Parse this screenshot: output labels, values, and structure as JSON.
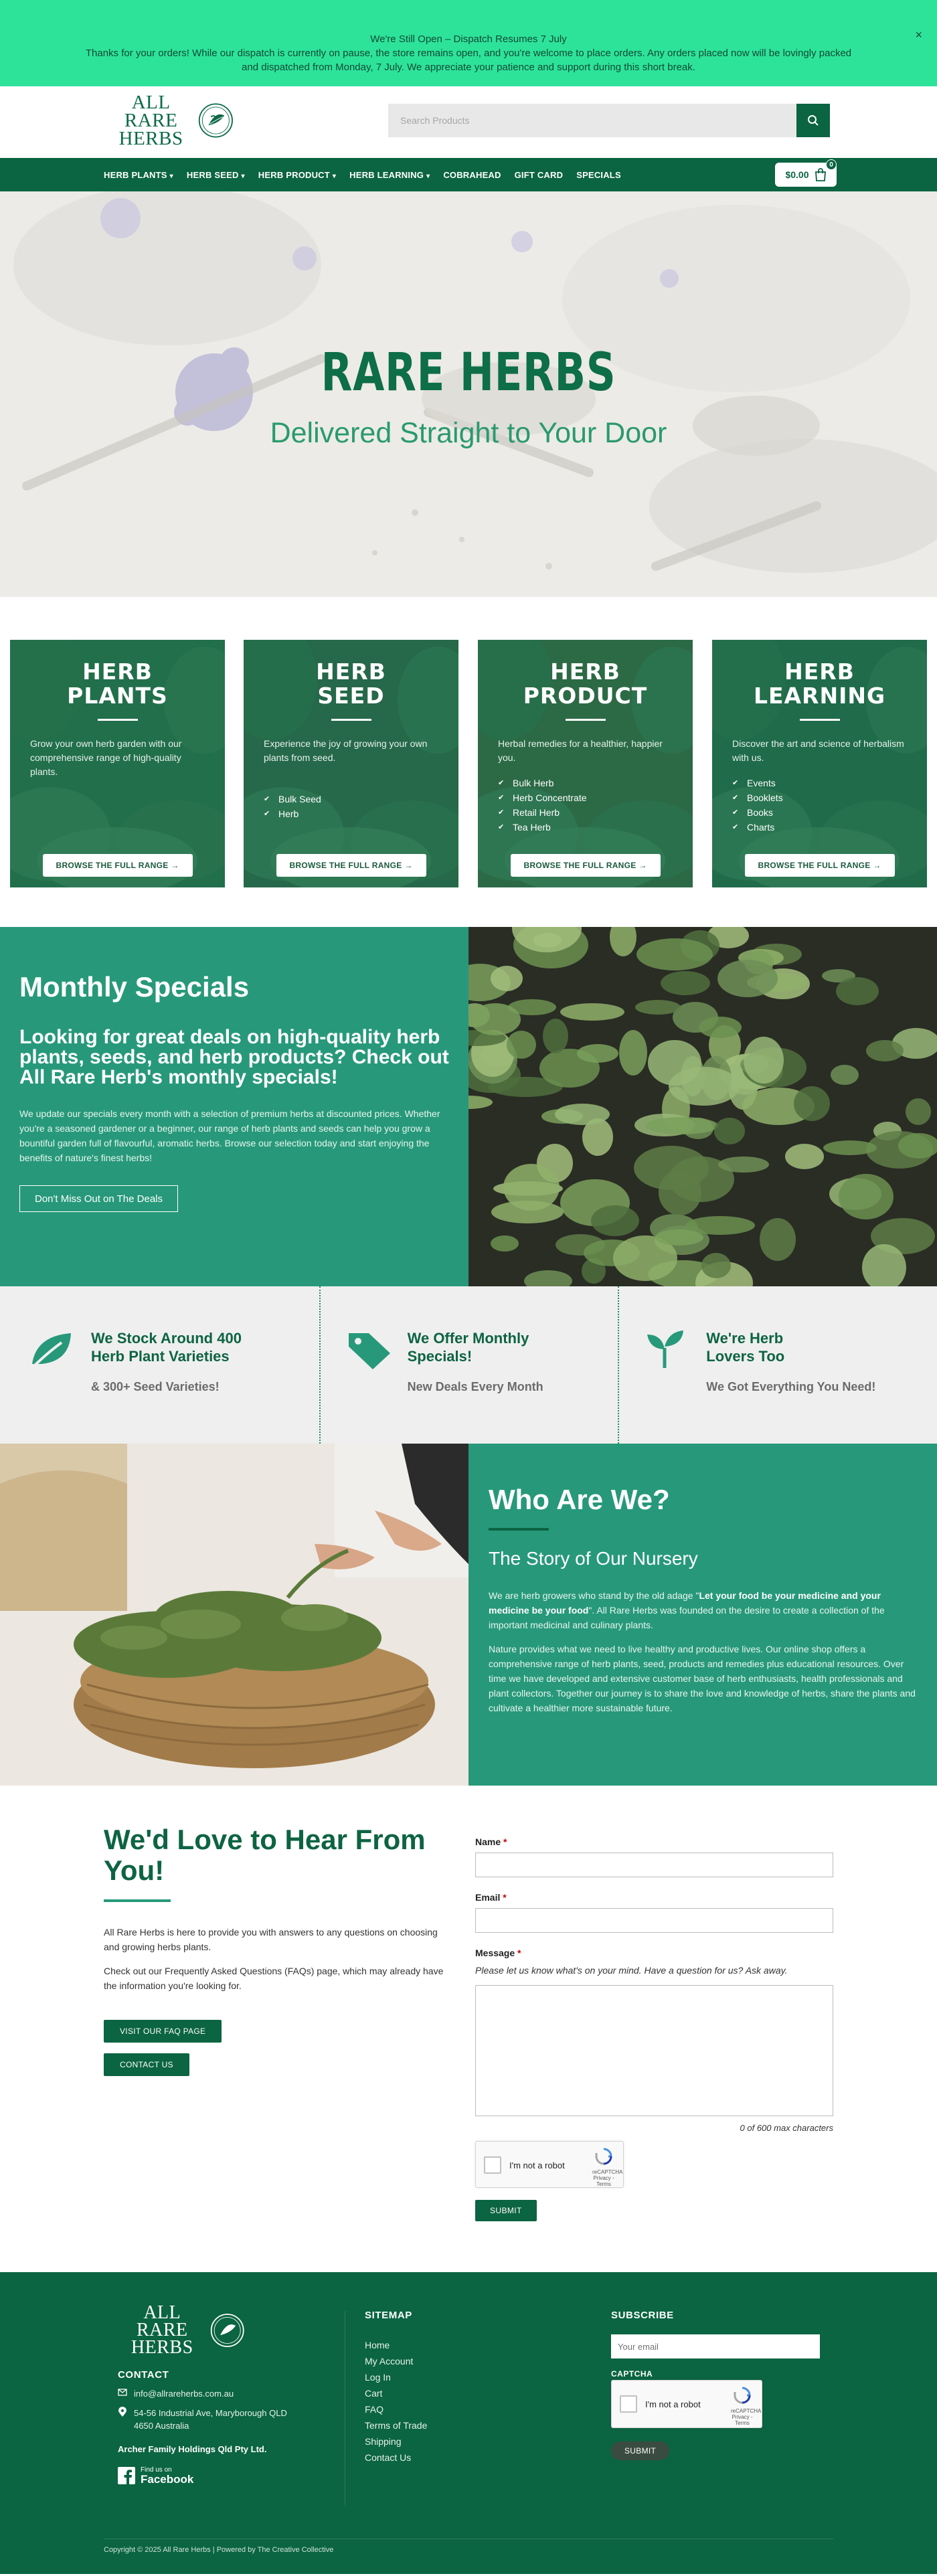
{
  "announcement": {
    "title": "We're Still Open – Dispatch Resumes 7 July",
    "body": "Thanks for your orders! While our dispatch is currently on pause, the store remains open, and you're welcome to place orders. Any orders placed now will be lovingly packed and dispatched from Monday, 7 July. We appreciate your patience and support during this short break.",
    "close": "×"
  },
  "header": {
    "logo_line1": "ALL RARE",
    "logo_line2": "HERBS",
    "search_placeholder": "Search Products"
  },
  "nav": {
    "items": [
      {
        "label": "HERB PLANTS",
        "dropdown": true
      },
      {
        "label": "HERB SEED",
        "dropdown": true
      },
      {
        "label": "HERB PRODUCT",
        "dropdown": true
      },
      {
        "label": "HERB LEARNING",
        "dropdown": true
      },
      {
        "label": "COBRAHEAD",
        "dropdown": false
      },
      {
        "label": "GIFT CARD",
        "dropdown": false
      },
      {
        "label": "SPECIALS",
        "dropdown": false
      }
    ],
    "cart_total": "$0.00",
    "cart_count": "0"
  },
  "hero": {
    "title": "RARE HERBS",
    "subtitle": "Delivered Straight to Your Door"
  },
  "categories": [
    {
      "title1": "HERB",
      "title2": "PLANTS",
      "desc": "Grow your own herb garden with our comprehensive range of high-quality plants.",
      "items": [],
      "button": "BROWSE THE FULL RANGE →",
      "bg": "#226f4b"
    },
    {
      "title1": "HERB",
      "title2": "SEED",
      "desc": "Experience the joy of growing your own plants from seed.",
      "items": [
        "Bulk Seed",
        "Herb"
      ],
      "button": "BROWSE THE FULL RANGE →",
      "bg": "#26684a"
    },
    {
      "title1": "HERB",
      "title2": "PRODUCT",
      "desc": "Herbal remedies for a healthier, happier you.",
      "items": [
        "Bulk Herb",
        "Herb Concentrate",
        "Retail Herb",
        "Tea Herb"
      ],
      "button": "BROWSE THE FULL RANGE →",
      "bg": "#2c6a46"
    },
    {
      "title1": "HERB",
      "title2": "LEARNING",
      "desc": "Discover the art and science of herbalism with us.",
      "items": [
        "Events",
        "Booklets",
        "Books",
        "Charts"
      ],
      "button": "BROWSE THE FULL RANGE →",
      "bg": "#1f6b4a"
    }
  ],
  "specials": {
    "title": "Monthly Specials",
    "lead": "Looking for great deals on high-quality herb plants, seeds, and herb products? Check out All Rare Herb's monthly specials!",
    "body": "We update our specials every month with a selection of premium herbs at discounted prices. Whether you're a seasoned gardener or a beginner, our range of herb plants and seeds can help you grow a bountiful garden full of flavourful, aromatic herbs. Browse our selection today and start enjoying the benefits of nature's finest herbs!",
    "button": "Don't Miss Out on The Deals"
  },
  "features": [
    {
      "icon": "leaf-icon",
      "title1": "We Stock Around 400",
      "title2": "Herb Plant Varieties",
      "sub": "& 300+ Seed Varieties!"
    },
    {
      "icon": "tag-icon",
      "title1": "We Offer Monthly",
      "title2": "Specials!",
      "sub": "New Deals Every Month"
    },
    {
      "icon": "sprout-icon",
      "title1": "We're Herb",
      "title2": "Lovers Too",
      "sub": "We Got Everything You Need!"
    }
  ],
  "about": {
    "title": "Who Are We?",
    "subtitle": "The Story of Our Nursery",
    "p1_before": "We are herb growers who stand by the old adage \"",
    "p1_bold": "Let your food be your medicine and your medicine be your food",
    "p1_after": "\". All Rare Herbs was founded on the desire to create a collection of the important medicinal and culinary plants.",
    "p2": "Nature provides what we need to live healthy and productive lives. Our online shop offers a comprehensive range of herb plants, seed, products and remedies plus educational resources. Over time we have developed and extensive customer base of herb enthusiasts, health professionals and plant collectors. Together our journey is to share the love and knowledge of herbs, share the plants and cultivate a healthier more sustainable future."
  },
  "contact": {
    "title": "We'd Love to Hear From You!",
    "p1": "All Rare Herbs is here to provide you with answers to any questions on choosing and growing herbs plants.",
    "p2": "Check out our Frequently Asked Questions (FAQs) page, which may already have the information you're looking for.",
    "faq_button": "VISIT OUR FAQ PAGE",
    "contact_button": "CONTACT US",
    "form": {
      "name_label": "Name",
      "email_label": "Email",
      "message_label": "Message",
      "required": "*",
      "message_help": "Please let us know what's on your mind. Have a question for us? Ask away.",
      "counter": "0 of 600 max characters",
      "captcha_label": "I'm not a robot",
      "captcha_brand": "reCAPTCHA",
      "captcha_links": "Privacy - Terms",
      "submit": "SUBMIT"
    }
  },
  "footer": {
    "logo_line1": "ALL RARE",
    "logo_line2": "HERBS",
    "contact_heading": "CONTACT",
    "email": "info@allrareherbs.com.au",
    "address1": "54-56 Industrial Ave, Maryborough QLD",
    "address2": "4650 Australia",
    "company": "Archer Family Holdings Qld Pty Ltd.",
    "fb_small1": "Find us on",
    "fb_big": "Facebook",
    "sitemap_heading": "SITEMAP",
    "sitemap": [
      "Home",
      "My Account",
      "Log In",
      "Cart",
      "FAQ",
      "Terms of Trade",
      "Shipping",
      "Contact Us"
    ],
    "subscribe_heading": "SUBSCRIBE",
    "email_placeholder": "Your email",
    "captcha_heading": "CAPTCHA",
    "subscribe_button": "SUBMIT",
    "copyright": "Copyright © 2025 All Rare Herbs | Powered by The Creative Collective"
  },
  "colors": {
    "brand_dark": "#0b6442",
    "brand_mid": "#27997a",
    "announce_bg": "#2de39a"
  }
}
